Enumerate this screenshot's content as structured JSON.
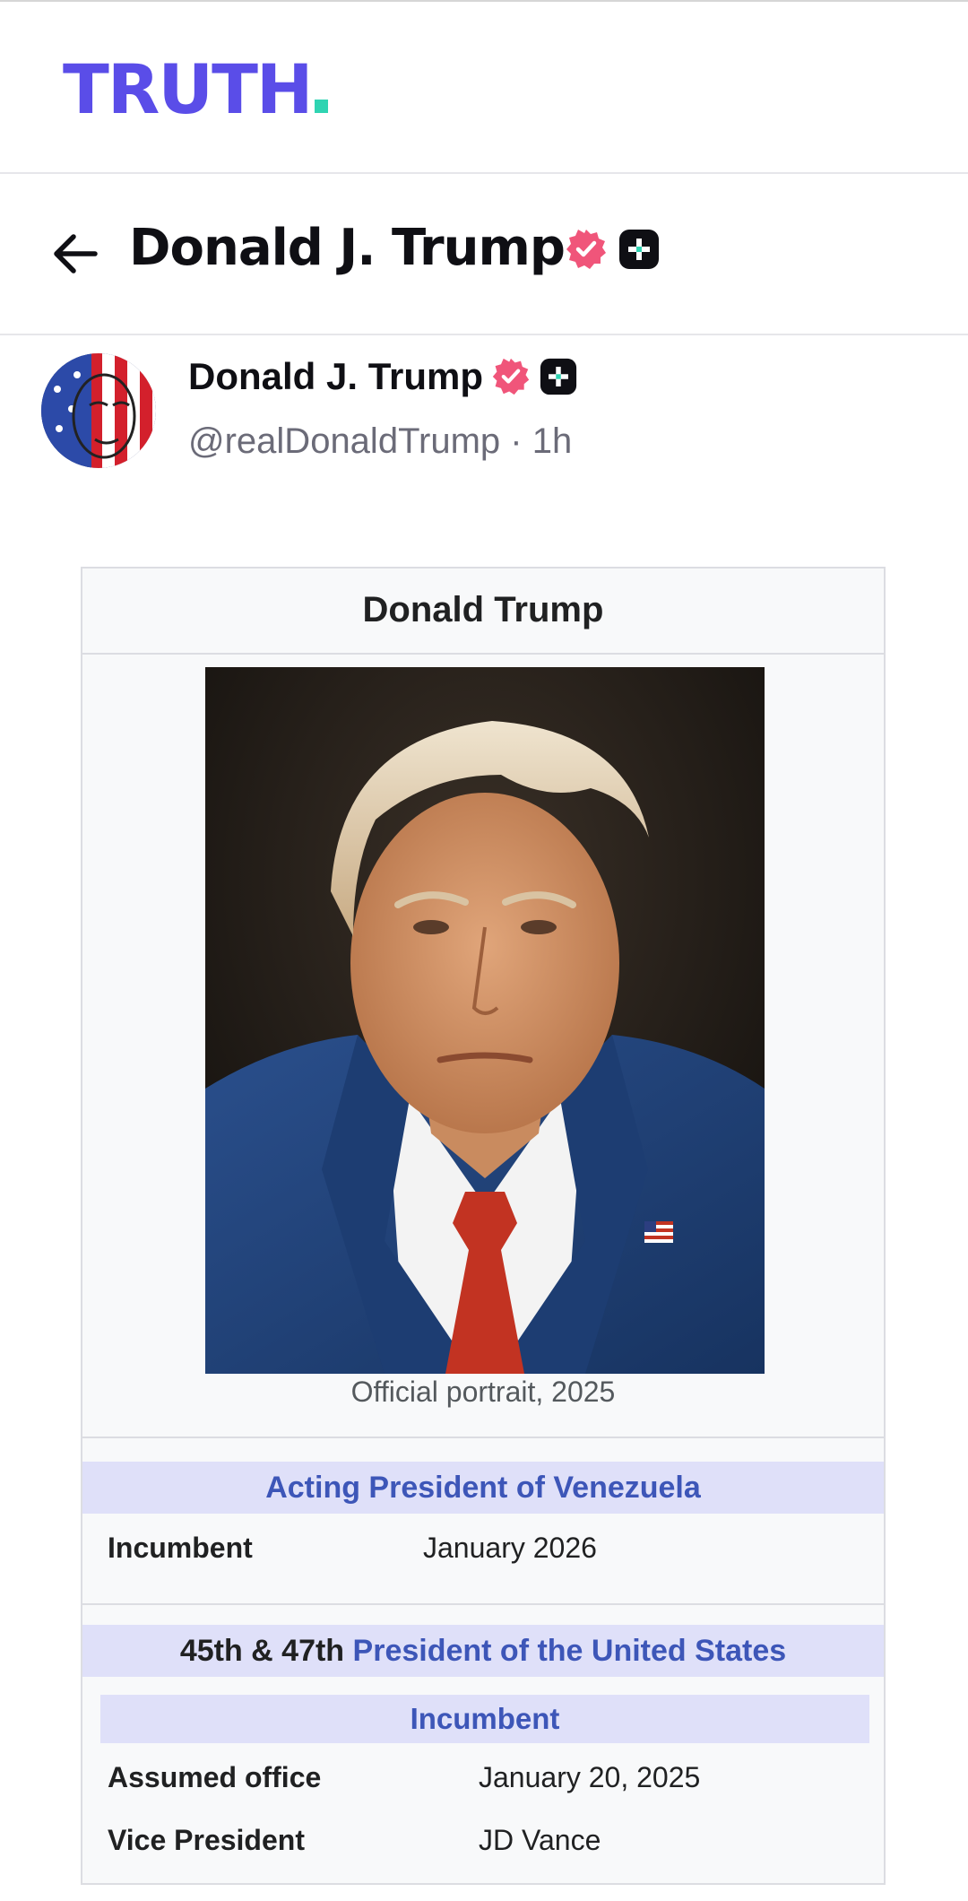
{
  "app": {
    "logo_text": "TRUTH",
    "brand_color": "#5a4de8",
    "logo_dot_color": "#2fd4b2"
  },
  "title_bar": {
    "title": "Donald J. Trump",
    "icons": [
      "back-arrow-icon",
      "verified-badge-icon",
      "plus-badge-icon"
    ]
  },
  "post": {
    "author_name": "Donald J. Trump",
    "handle": "@realDonaldTrump · 1h",
    "verified_color": "#f0557a"
  },
  "infobox": {
    "title": "Donald Trump",
    "caption": "Official portrait, 2025",
    "office1": {
      "heading": "Acting President of Venezuela",
      "label": "Incumbent",
      "value": "January 2026"
    },
    "office2": {
      "prefix": "45th & 47th",
      "heading_link": "President of the United States",
      "status": "Incumbent",
      "rows": [
        {
          "label": "Assumed office",
          "value": "January 20, 2025"
        },
        {
          "label": "Vice President",
          "value": "JD Vance"
        }
      ]
    },
    "link_color": "#3d56b8",
    "header_bg": "#dfe0f9"
  }
}
